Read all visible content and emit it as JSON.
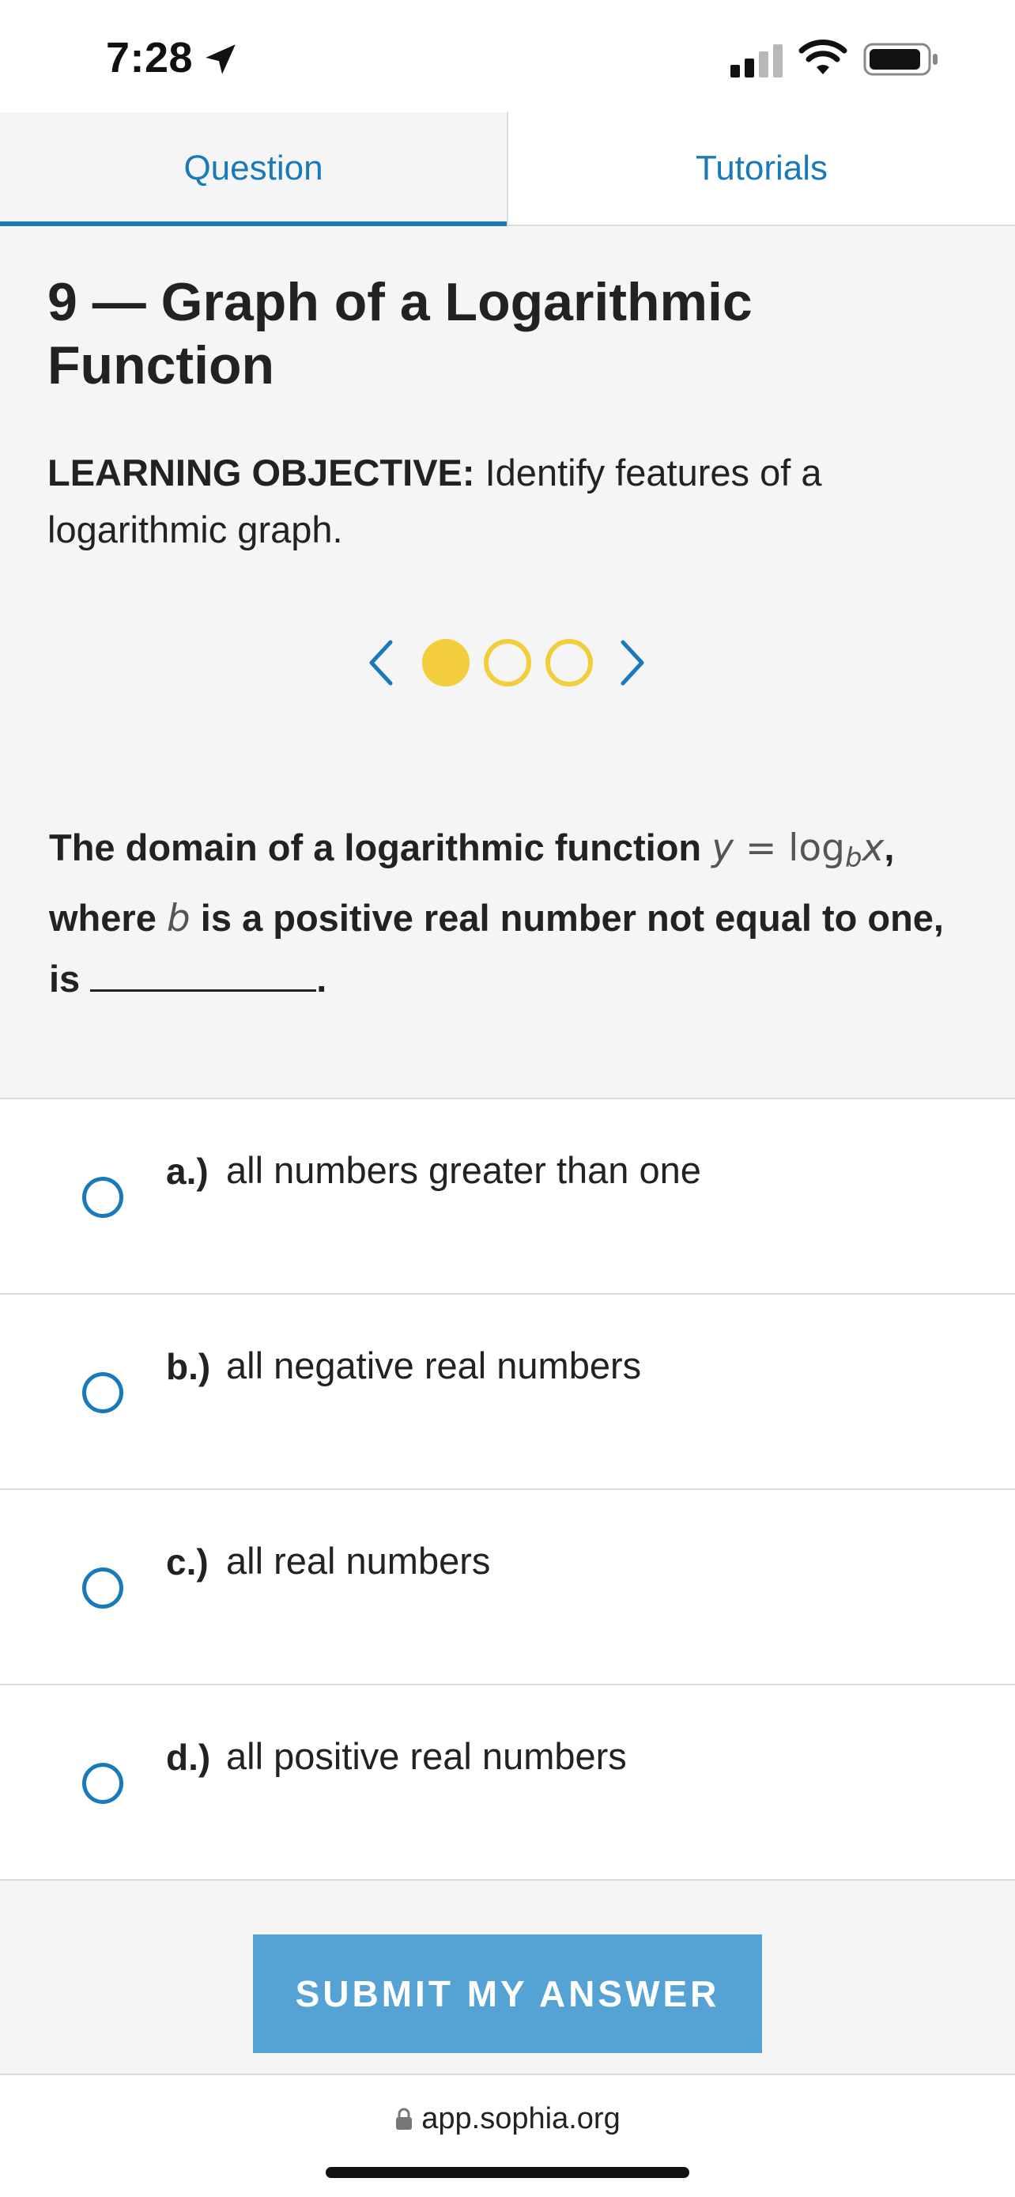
{
  "status_bar": {
    "time": "7:28"
  },
  "tabs": [
    {
      "label": "Question",
      "active": true
    },
    {
      "label": "Tutorials",
      "active": false
    }
  ],
  "page": {
    "title": "9 — Graph of a Logarithmic Function",
    "objective_label": "LEARNING OBJECTIVE:",
    "objective_text": " Identify features of a logarithmic graph."
  },
  "carousel": {
    "dots": 3,
    "active_index": 0
  },
  "question": {
    "text_1": "The domain of a logarithmic function ",
    "math_y": "y",
    "math_eq": " = log",
    "math_sub": "b",
    "math_x": "x",
    "text_2": ", where ",
    "math_b": "b",
    "text_3": " is a positive real number not equal to one, is ",
    "text_4": "."
  },
  "options": [
    {
      "letter": "a.)",
      "text": "all numbers greater than one"
    },
    {
      "letter": "b.)",
      "text": "all negative real numbers"
    },
    {
      "letter": "c.)",
      "text": "all real numbers"
    },
    {
      "letter": "d.)",
      "text": "all positive real numbers"
    }
  ],
  "submit": {
    "label": "SUBMIT MY ANSWER"
  },
  "browser": {
    "url": "app.sophia.org"
  },
  "colors": {
    "accent": "#1a7ab9",
    "dot": "#f2cd3c",
    "button": "#55a3d5"
  }
}
